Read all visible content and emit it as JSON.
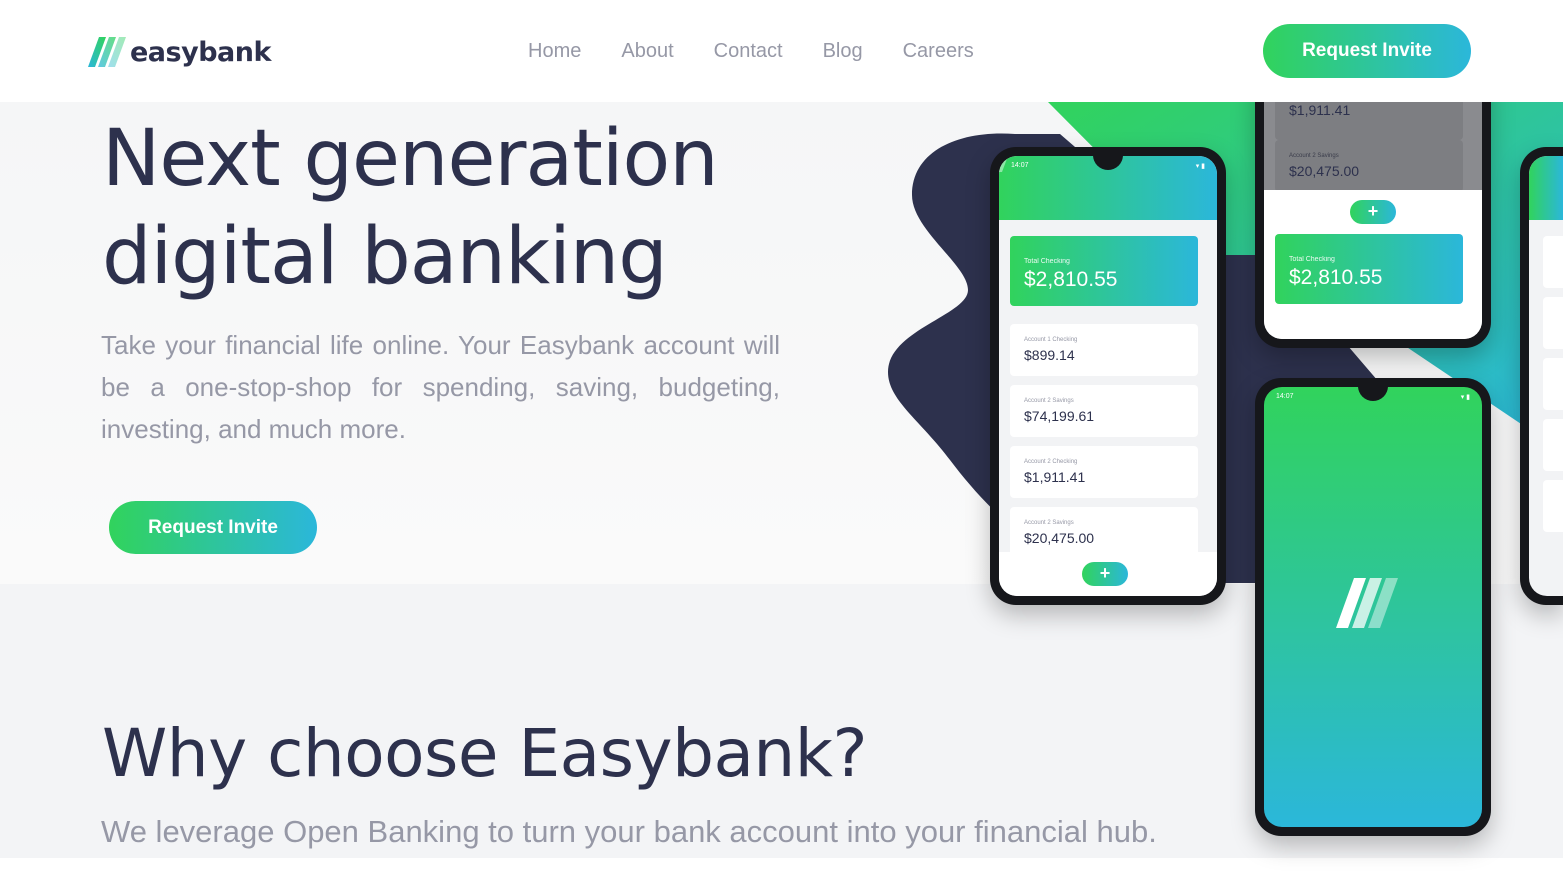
{
  "brand": {
    "name": "easybank"
  },
  "nav": {
    "items": [
      "Home",
      "About",
      "Contact",
      "Blog",
      "Careers"
    ]
  },
  "header": {
    "cta_label": "Request Invite"
  },
  "hero": {
    "title_line1": "Next generation",
    "title_line2": "digital banking",
    "description": "Take your financial life online. Your Easybank account will be a one-stop-shop for spending, saving, budgeting, investing, and much more.",
    "cta_label": "Request Invite"
  },
  "why": {
    "title": "Why choose Easybank?",
    "description": "We leverage Open Banking to turn your bank account into your financial hub."
  },
  "mockup": {
    "phone_left": {
      "status_time": "14:07",
      "total_label": "Total Checking",
      "total_amount": "$2,810.55",
      "accounts": [
        {
          "label": "Account 1 Checking",
          "amount": "$899.14"
        },
        {
          "label": "Account 2 Savings",
          "amount": "$74,199.61"
        },
        {
          "label": "Account 2 Checking",
          "amount": "$1,911.41"
        },
        {
          "label": "Account 2 Savings",
          "amount": "$20,475.00"
        }
      ],
      "fab": "+"
    },
    "phone_top": {
      "amount_1": "$1,911.41",
      "label_2": "Account 2 Savings",
      "amount_2": "$20,475.00",
      "total_label": "Total Checking",
      "total_amount": "$2,810.55",
      "fab": "+"
    },
    "phone_bottom": {
      "status_time": "14:07"
    }
  },
  "colors": {
    "dark_blue": "#2d314d",
    "grayish_blue": "#9698a6",
    "lime_green": "#31d35c",
    "bright_cyan": "#2bb7da",
    "light_bg": "#f3f4f6"
  },
  "icons": [
    "logo-stripes-icon",
    "plus-icon",
    "wifi-icon",
    "battery-icon"
  ]
}
